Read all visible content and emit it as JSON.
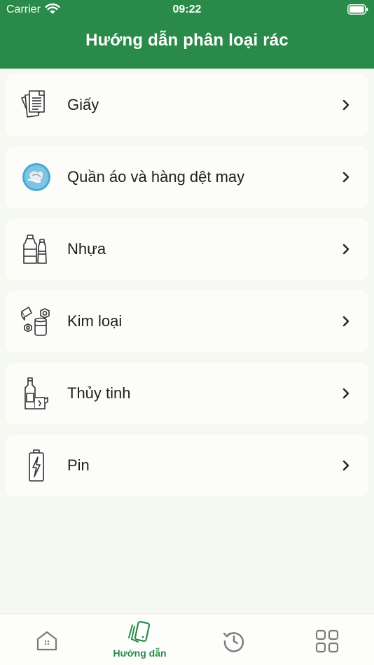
{
  "status_bar": {
    "carrier": "Carrier",
    "time": "09:22"
  },
  "header": {
    "title": "Hướng dẫn phân loại rác"
  },
  "categories": [
    {
      "label": "Giấy",
      "icon": "paper-icon"
    },
    {
      "label": "Quần áo và hàng dệt may",
      "icon": "clothing-icon"
    },
    {
      "label": "Nhựa",
      "icon": "plastic-bottles-icon"
    },
    {
      "label": "Kim loại",
      "icon": "metal-cans-icon"
    },
    {
      "label": "Thủy tinh",
      "icon": "glass-bottles-icon"
    },
    {
      "label": "Pin",
      "icon": "battery-icon"
    }
  ],
  "tabbar": {
    "tabs": [
      {
        "label": "",
        "icon": "home-icon"
      },
      {
        "label": "Hướng dẫn",
        "icon": "guide-cards-icon",
        "active": true
      },
      {
        "label": "",
        "icon": "history-icon"
      },
      {
        "label": "",
        "icon": "grid-icon"
      }
    ]
  },
  "colors": {
    "brand": "#2a8a49",
    "background": "#f5f9f2",
    "card": "#fcfdf9",
    "inactive_icon": "#7a7a7a"
  }
}
